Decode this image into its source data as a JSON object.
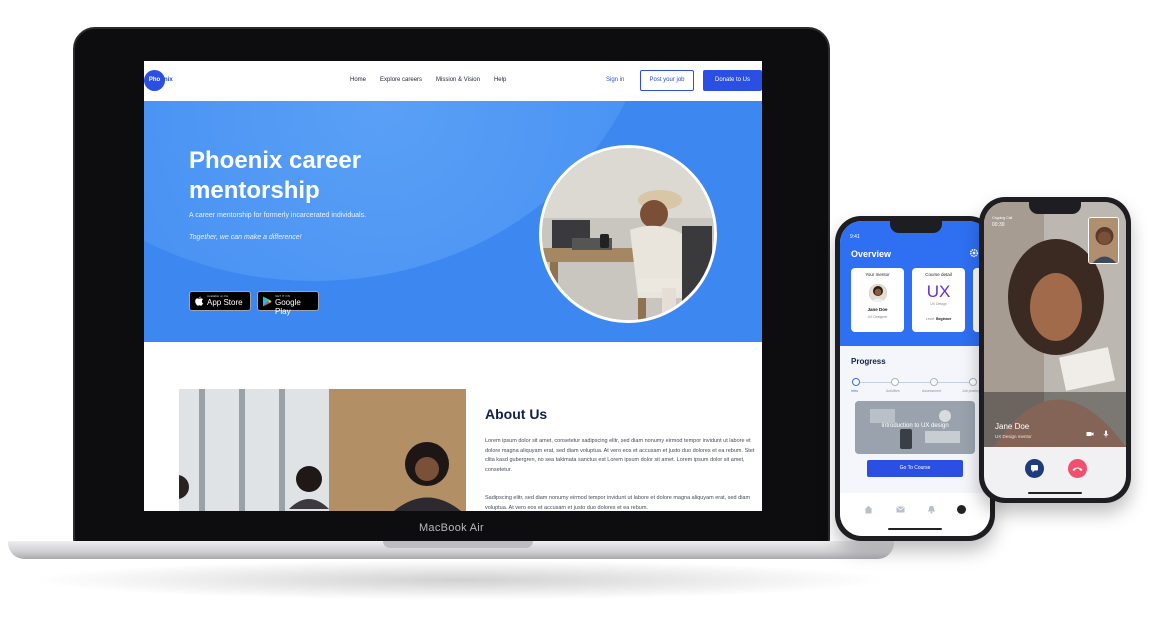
{
  "laptop": {
    "brand_label": "MacBook Air",
    "website": {
      "logo_text": "Phoenix",
      "nav": {
        "links": [
          "Home",
          "Explore careers",
          "Mission & Vision",
          "Help"
        ],
        "sign_in": "Sign in",
        "post_job": "Post your job",
        "donate": "Donate to Us"
      },
      "hero": {
        "title": "Phoenix career mentorship",
        "subtitle": "A career mentorship for formerly incarcerated individuals.",
        "tagline": "Together, we can make a difference!",
        "app_store": {
          "small": "Available on the",
          "big": "App Store"
        },
        "google_play": {
          "small": "GET IT ON",
          "big": "Google Play"
        }
      },
      "about": {
        "title": "About Us",
        "paragraph1": "Lorem ipsum dolor sit amet, consetetur sadipscing elitr, sed diam nonumy eirmod tempor invidunt ut labore et dolore magna aliquyam erat, sed diam voluptua. At vero eos et accusam et justo duo dolores et ea rebum. Stet clita kasd gubergren, no sea takimata sanctus est Lorem ipsum dolor sit amet. Lorem ipsum dolor sit amet, consetetur.",
        "paragraph2": "Sadipscing elitr, sed diam nonumy eirmod tempor invidunt ut labore et dolore magna aliquyam erat, sed diam voluptua. At vero eos et accusam et justo duo dolores et ea rebum."
      }
    }
  },
  "phone_app": {
    "status_time": "9:41",
    "header_title": "Overview",
    "cards": {
      "mentor": {
        "heading": "Your mentor",
        "name": "Jane Doe",
        "role": "UX Designer"
      },
      "course": {
        "heading": "Course detail",
        "code": "UX",
        "subtitle": "UX Design",
        "level_label": "Level:",
        "level_value": "Beginner"
      },
      "third_heading": "Ac"
    },
    "progress": {
      "title": "Progress",
      "steps": [
        "Intro",
        "Activities",
        "Assessment",
        "Job posting"
      ],
      "current_step_index": 0
    },
    "course_card_label": "Introduction to UX design",
    "go_button": "Go To Course"
  },
  "phone_call": {
    "status_label": "Ongoing Call",
    "call_time": "00:39",
    "caller_name": "Jane Doe",
    "caller_role": "UX Design mentor"
  },
  "colors": {
    "brand_blue": "#2b4fe3",
    "hero_blue": "#3d88f0",
    "app_blue": "#2f6ff2",
    "end_call_red": "#f0506e",
    "ux_purple": "#6a2fd6"
  }
}
